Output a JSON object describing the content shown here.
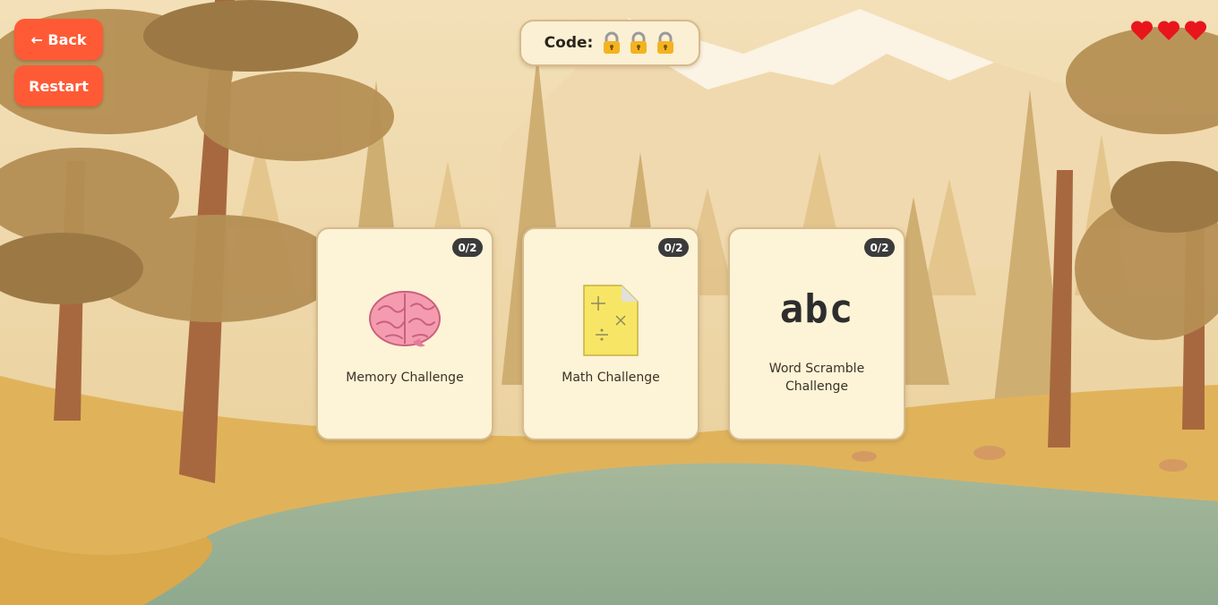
{
  "nav": {
    "back_label": "← Back",
    "restart_label": "Restart"
  },
  "code": {
    "label": "Code:",
    "locks": [
      "lock-icon",
      "lock-icon",
      "lock-icon"
    ]
  },
  "lives": {
    "hearts": 3,
    "icon": "heart-icon",
    "color": "#e8151d"
  },
  "challenges": [
    {
      "title": "Memory Challenge",
      "progress": "0/2",
      "icon": "brain-icon"
    },
    {
      "title": "Math Challenge",
      "progress": "0/2",
      "icon": "math-note-icon"
    },
    {
      "title": "Word Scramble Challenge",
      "progress": "0/2",
      "icon": "abc-icon",
      "icon_text": "abc"
    }
  ],
  "colors": {
    "button": "#ff5a36",
    "badge": "#3b3b3b",
    "card": "#fdf3d6",
    "heart": "#e8151d"
  }
}
